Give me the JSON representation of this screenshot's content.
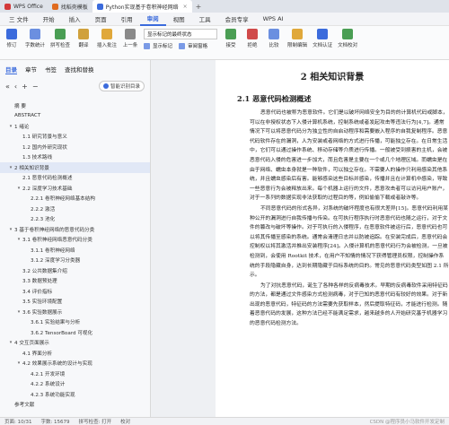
{
  "tabs": [
    {
      "label": "WPS Office",
      "color": "#d3393a",
      "active": false
    },
    {
      "label": "找稻壳模板",
      "color": "#e06b1f",
      "active": false
    },
    {
      "label": "Python实现基于卷积神经网络",
      "color": "#3b6bdc",
      "active": true
    }
  ],
  "menu": [
    "三 文件",
    "开始",
    "插入",
    "页面",
    "引用",
    "审阅",
    "视图",
    "工具",
    "会员专享",
    "WPS AI"
  ],
  "toolbar": {
    "buttons": [
      {
        "label": "修订",
        "icon": "revise-icon",
        "color": "#3b6bdc"
      },
      {
        "label": "字数统计",
        "icon": "word-count-icon",
        "color": "#6b8fe0"
      },
      {
        "label": "拼写检查",
        "icon": "spellcheck-icon",
        "color": "#4a9e54"
      },
      {
        "label": "翻译",
        "icon": "translate-icon",
        "color": "#d0a13c"
      },
      {
        "label": "插入批注",
        "icon": "comment-icon",
        "color": "#e0a83a"
      },
      {
        "label": "上一条",
        "icon": "prev-icon",
        "color": "#8a8a8a"
      }
    ],
    "markup_select": "显示标记的最终状态",
    "show_markup": "显示标记",
    "review_pane": "审阅窗格",
    "accept": "接受",
    "reject": "拒绝",
    "compare": "比较",
    "restrict": "限制编辑",
    "doc_verify": "文档认证",
    "doc_check": "文档校对"
  },
  "nav": {
    "tabs": [
      "目录",
      "章节",
      "书签",
      "查找和替换"
    ],
    "tools": [
      "«",
      "‹",
      "+",
      "−"
    ],
    "smart": "智能识别目录",
    "outline": [
      {
        "label": "摘    要",
        "level": 0,
        "caret": ""
      },
      {
        "label": "ABSTRACT",
        "level": 0,
        "caret": ""
      },
      {
        "label": "1 绪论",
        "level": 0,
        "caret": "▾"
      },
      {
        "label": "1.1 研究背景与意义",
        "level": 1,
        "caret": ""
      },
      {
        "label": "1.2 国内外研究现状",
        "level": 1,
        "caret": ""
      },
      {
        "label": "1.3 技术路线",
        "level": 1,
        "caret": ""
      },
      {
        "label": "2 相关知识背景",
        "level": 0,
        "caret": "▾",
        "selected": true
      },
      {
        "label": "2.1 恶意代码检测概述",
        "level": 1,
        "caret": ""
      },
      {
        "label": "2.2 深度学习技术基础",
        "level": 1,
        "caret": "▾"
      },
      {
        "label": "2.2.1 卷积神经网络基本结构",
        "level": 2,
        "caret": ""
      },
      {
        "label": "2.2.2 激活",
        "level": 2,
        "caret": ""
      },
      {
        "label": "2.2.3 池化",
        "level": 2,
        "caret": ""
      },
      {
        "label": "3 基于卷积神经网络的恶意代码分类",
        "level": 0,
        "caret": "▾"
      },
      {
        "label": "3.1 卷积神经网络恶意代码分类",
        "level": 1,
        "caret": "▾"
      },
      {
        "label": "3.1.1 卷积神经网络",
        "level": 2,
        "caret": ""
      },
      {
        "label": "3.1.2 深度学习分类器",
        "level": 2,
        "caret": ""
      },
      {
        "label": "3.2 公共数据集介绍",
        "level": 1,
        "caret": ""
      },
      {
        "label": "3.3 数据预处理",
        "level": 1,
        "caret": ""
      },
      {
        "label": "3.4 评价指标",
        "level": 1,
        "caret": ""
      },
      {
        "label": "3.5 实验环境配置",
        "level": 1,
        "caret": ""
      },
      {
        "label": "3.6 实验数据展示",
        "level": 1,
        "caret": "▾"
      },
      {
        "label": "3.6.1 实验结果与分析",
        "level": 2,
        "caret": ""
      },
      {
        "label": "3.6.2 TensorBoard 可视化",
        "level": 2,
        "caret": ""
      },
      {
        "label": "4 交互页面展示",
        "level": 0,
        "caret": "▾"
      },
      {
        "label": "4.1 界面分析",
        "level": 1,
        "caret": ""
      },
      {
        "label": "4.2 效果展示系统的设计与实现",
        "level": 1,
        "caret": "▾"
      },
      {
        "label": "4.2.1 开发环境",
        "level": 2,
        "caret": ""
      },
      {
        "label": "4.2.2 系统设计",
        "level": 2,
        "caret": ""
      },
      {
        "label": "4.2.3 系统功能实现",
        "level": 2,
        "caret": ""
      },
      {
        "label": "参考文献",
        "level": 0,
        "caret": ""
      }
    ]
  },
  "doc": {
    "chapter_title": "2  相关知识背景",
    "section_title": "2.1  恶意代码检测概述",
    "paragraphs": [
      "恶意代码也被称为恶意软件。它们是以破坏网络安全为目的的计算机代码或脚本，可以在非授权状态下入侵计算机系统，控制系统或者发起攻击等违法行为[4,7]。通常情况下可以将恶意代码分为独立性的自启动程序和需要嵌入程序的自我复制程序。恶意代码软件存在的漏洞，人为安装或者网络的方式进行传播，可能独立存在。在日常生活中，它们可以通过操作系统、移动存储等介质进行传播。一般被受到损害的主机，会被恶意代码入侵的危害进一步加大，而且危害是主要在一个或几个地理区域。而蠕虫是在由于网络、蠕虫本身就是一种软件，可以独立存在。不需要人的操作只利用感染其他系统，并且蠕虫感染后有害。能够感染这些目标并感染，传播并且在计算机中感染，导致一些恶意行为会被释放出来。每个机器上运行的文件，恶意攻击者可以访问用户账户，对于一系列的数据实现非法获取的过程目的等，例如偷偷下载或者敲诈等。",
      "不同恶意代码的形式各异，对系统的破坏程度也有很大差异[15]。恶意代码利用某种公开的漏洞进行自我传播与传染。在可执行程序执行时恶意代码也随之运行，对于文件的篡改与破坏等操作。对于可执行的入侵程序，在恶意软件被运行后，恶意代码也可以将其传播至感染的系统。通常会清理日志并以防被追踪。在安装完成后，恶意代码会控制权以将其激活并推出安装程序[24]。入侵计算机的恶意代码行为会被检测，一旦被检测到，会使用 Rootkit 技术，在用户不知情的情况下获得管理员权限，控制操作系统的手段隐藏自身，达到长期隐藏于目标系统的目的。常见的恶意代码类型如图 2.1 所示。",
      "为了对抗恶意代码，诞生了各种各样的反病毒技术。早期的反病毒软件采用特征码的方法，都是通过文件感染方式检测病毒，对于已知的恶意代码有较好的效果。对于新出现的恶意代码，特征码的方法需要先获取样本，然后提取特征码，才能进行检测。随着恶意代码的发展，这种方法已经不能满足需求，越来越多的人开始研究基于机器学习的恶意代码检测方法。"
    ]
  },
  "status": {
    "page": "页面: 10/31",
    "words": "字数: 15679",
    "spell": "拼写检查: 打开",
    "proof": "校对",
    "watermark": "CSDN @程序员小马软件开发定制"
  }
}
